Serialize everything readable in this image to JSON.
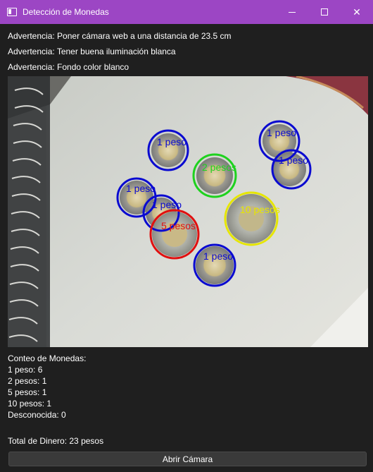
{
  "window": {
    "title": "Detección de Monedas",
    "close_glyph": "✕"
  },
  "warnings": [
    "Advertencia: Poner cámara web a una distancia de 23.5 cm",
    "Advertencia: Tener buena iluminación blanca",
    "Advertencia: Fondo color blanco"
  ],
  "camera": {
    "detections": [
      {
        "label": "1 peso",
        "color": "#0a0ad0"
      },
      {
        "label": "1 peso",
        "color": "#0a0ad0"
      },
      {
        "label": "1 peso",
        "color": "#0a0ad0"
      },
      {
        "label": "2 pesos",
        "color": "#1ed21e"
      },
      {
        "label": "1 peso",
        "color": "#0a0ad0"
      },
      {
        "label": "1 peso",
        "color": "#0a0ad0"
      },
      {
        "label": "10 pesos",
        "color": "#e6e600"
      },
      {
        "label": "5 pesos",
        "color": "#e01010"
      },
      {
        "label": "1 peso",
        "color": "#0a0ad0"
      }
    ]
  },
  "counts": {
    "heading": "Conteo de Monedas:",
    "one_peso": "1 peso: 6",
    "two_pesos": "2 pesos: 1",
    "five_pesos": "5 pesos: 1",
    "ten_pesos": "10 pesos: 1",
    "unknown": "Desconocida: 0"
  },
  "total": "Total de Dinero: 23 pesos",
  "open_camera_button": "Abrir Cámara"
}
